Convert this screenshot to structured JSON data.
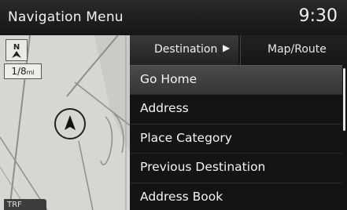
{
  "header": {
    "title": "Navigation Menu",
    "clock": "9:30"
  },
  "map": {
    "scale": "1/8",
    "scale_unit": "mi",
    "traffic_label": "TRF"
  },
  "tabs": [
    {
      "label": "Destination",
      "arrow": "▶"
    },
    {
      "label": "Map/Route"
    }
  ],
  "menu": {
    "items": [
      {
        "label": "Go Home"
      },
      {
        "label": "Address"
      },
      {
        "label": "Place Category"
      },
      {
        "label": "Previous Destination"
      },
      {
        "label": "Address Book"
      }
    ]
  }
}
